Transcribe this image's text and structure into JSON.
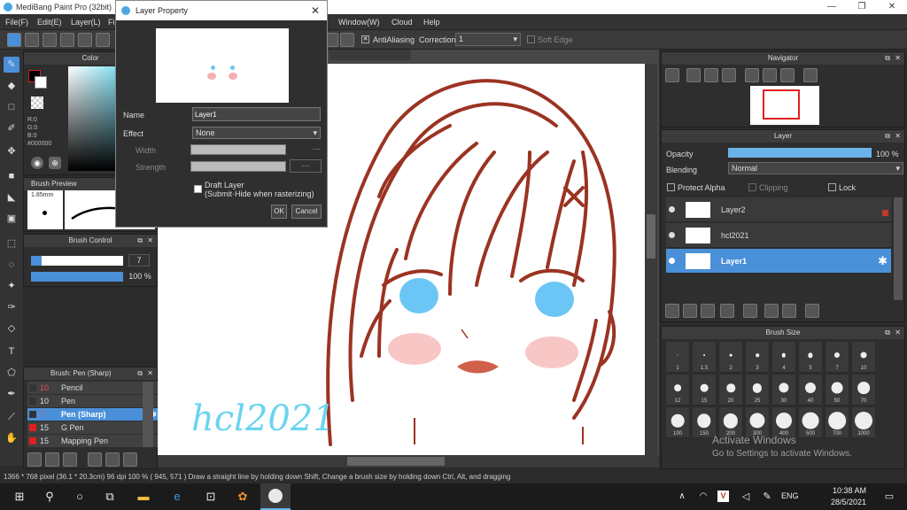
{
  "app": {
    "title": "MediBang Paint Pro (32bit)"
  },
  "menu": [
    "File(F)",
    "Edit(E)",
    "Layer(L)",
    "Fi",
    "Window(W)",
    "Cloud",
    "Help"
  ],
  "toolbar": {
    "antialias_label": "AntiAliasing",
    "correction_label": "Correction",
    "correction_value": "1",
    "softedge_label": "Soft Edge"
  },
  "color_panel": {
    "title": "Color",
    "r": "R:0",
    "g": "G:0",
    "b": "B:0",
    "hex": "#000000"
  },
  "brush_preview": {
    "title": "Brush Preview",
    "size": "1.85mm"
  },
  "brush_control": {
    "title": "Brush Control",
    "size_value": "7",
    "opacity_value": "100 %"
  },
  "brush_list": {
    "title": "Brush: Pen (Sharp)",
    "items": [
      {
        "size": "10",
        "name": "Pencil",
        "color": "#333333"
      },
      {
        "size": "10",
        "name": "Pen",
        "color": "#333333"
      },
      {
        "size": "7",
        "name": "Pen (Sharp)",
        "color": "#333333",
        "selected": true
      },
      {
        "size": "15",
        "name": "G Pen",
        "color": "#e02020"
      },
      {
        "size": "15",
        "name": "Mapping Pen",
        "color": "#e02020"
      }
    ]
  },
  "dialog": {
    "title": "Layer Property",
    "name_label": "Name",
    "name_value": "Layer1",
    "effect_label": "Effect",
    "effect_value": "None",
    "width_label": "Width",
    "strength_label": "Strength",
    "width_value": "---",
    "strength_value": "---",
    "draft_label": "Draft Layer",
    "draft_sub": "(Submit·Hide when rasterizing)",
    "ok_label": "OK",
    "cancel_label": "Cancel"
  },
  "canvas": {
    "signature": "hcl2021"
  },
  "navigator": {
    "title": "Navigator"
  },
  "layer_panel": {
    "title": "Layer",
    "opacity_label": "Opacity",
    "opacity_value": "100 %",
    "opacity_fraction": 1.0,
    "blending_label": "Blending",
    "blending_value": "Normal",
    "protect_alpha": "Protect Alpha",
    "clipping": "Clipping",
    "lock": "Lock",
    "layers": [
      {
        "name": "Layer2",
        "selected": false
      },
      {
        "name": "hcl2021",
        "selected": false
      },
      {
        "name": "Layer1",
        "selected": true
      }
    ]
  },
  "brush_size": {
    "title": "Brush Size",
    "sizes": [
      "1",
      "1.5",
      "2",
      "3",
      "4",
      "5",
      "7",
      "10",
      "12",
      "15",
      "20",
      "25",
      "30",
      "40",
      "50",
      "70",
      "100",
      "150",
      "200",
      "300",
      "400",
      "500",
      "700",
      "1000"
    ]
  },
  "activate": {
    "line1": "Activate Windows",
    "line2": "Go to Settings to activate Windows."
  },
  "status": {
    "text": "1366 * 768 pixel  (36.1 * 20.3cm)  96 dpi  100 %  ( 945, 571 )  Draw a straight line by holding down Shift, Change a brush size by holding down Ctrl, Alt, and dragging"
  },
  "taskbar": {
    "lang": "ENG",
    "time": "10:38 AM",
    "date": "28/5/2021"
  },
  "colors": {
    "accent": "#4a90d9",
    "hair": "#9b3322",
    "eye": "#6cc6f5",
    "blush": "#f5a0a0"
  }
}
